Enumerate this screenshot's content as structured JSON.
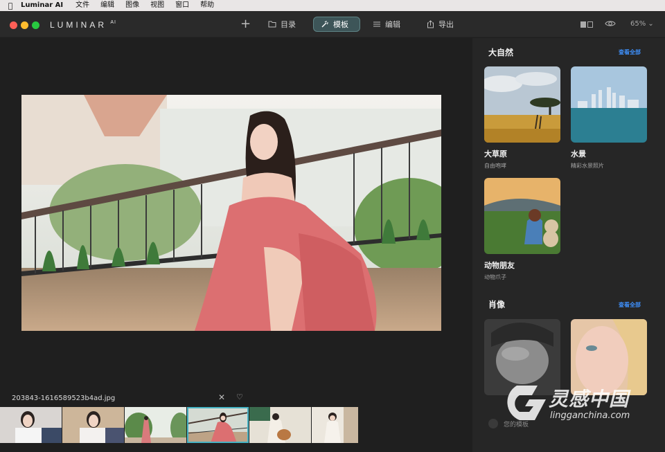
{
  "menubar": {
    "apple": "",
    "app_name": "Luminar AI",
    "items": [
      "文件",
      "编辑",
      "图像",
      "视图",
      "窗口",
      "帮助"
    ]
  },
  "toolbar": {
    "logo": "LUMINAR",
    "logo_suffix": "AI",
    "add_label": "+",
    "catalog_label": "目录",
    "templates_label": "模板",
    "edit_label": "编辑",
    "export_label": "导出",
    "zoom": "65%"
  },
  "canvas": {
    "file_name": "203843-1616589523b4ad.jpg",
    "close_glyph": "✕",
    "heart_glyph": "♡"
  },
  "filmstrip": {
    "count": 6,
    "selected_index": 3
  },
  "panel": {
    "nature": {
      "title": "大自然",
      "see_all": "查看全部",
      "cards": [
        {
          "name": "大草原",
          "sub": "自由咆哮"
        },
        {
          "name": "水景",
          "sub": "精彩水景照片"
        },
        {
          "name": "动物朋友",
          "sub": "动物爪子"
        }
      ]
    },
    "portrait": {
      "title": "肖像",
      "see_all": "查看全部"
    },
    "your_templates": "您的模板"
  },
  "watermark": {
    "cn": "灵感中国",
    "en": "lingganchina.com"
  },
  "colors": {
    "accent": "#46b3c4",
    "link": "#3e8ef7",
    "templates_active_bg": "#3d5558"
  }
}
